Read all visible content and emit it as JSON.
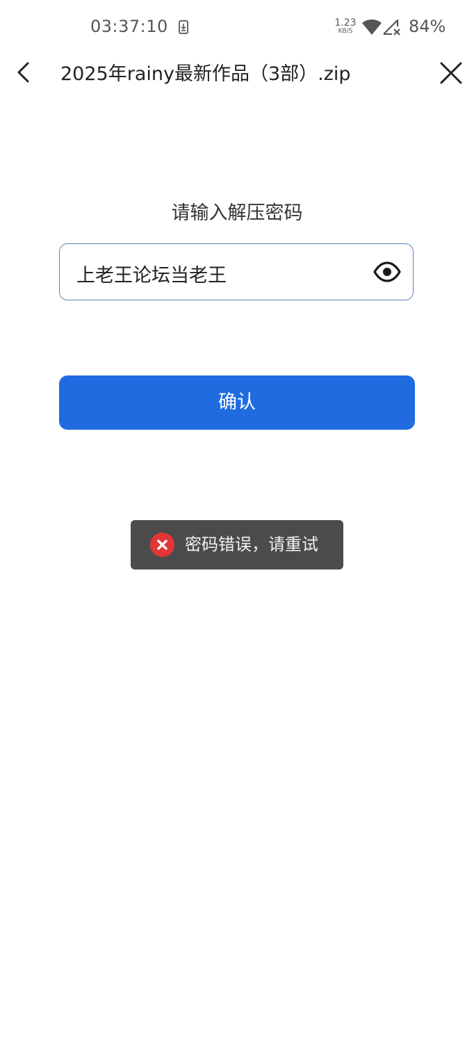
{
  "status_bar": {
    "time": "03:37:10",
    "net_speed_value": "1.23",
    "net_speed_unit": "KB/S",
    "battery": "84%",
    "icons": [
      "download-notification-icon",
      "wifi-icon",
      "signal-no-service-icon"
    ]
  },
  "header": {
    "title": "2025年rainy最新作品（3部）.zip",
    "back_icon": "chevron-left-icon",
    "close_icon": "close-icon"
  },
  "main": {
    "prompt": "请输入解压密码",
    "password_value": "上老王论坛当老王",
    "visibility_icon": "eye-icon",
    "confirm_label": "确认"
  },
  "toast": {
    "message": "密码错误，请重试",
    "icon": "error-x-icon"
  },
  "colors": {
    "accent": "#206be0",
    "field_border": "#5b84b8",
    "toast_bg": "#4b4b4b",
    "error": "#e33535"
  }
}
